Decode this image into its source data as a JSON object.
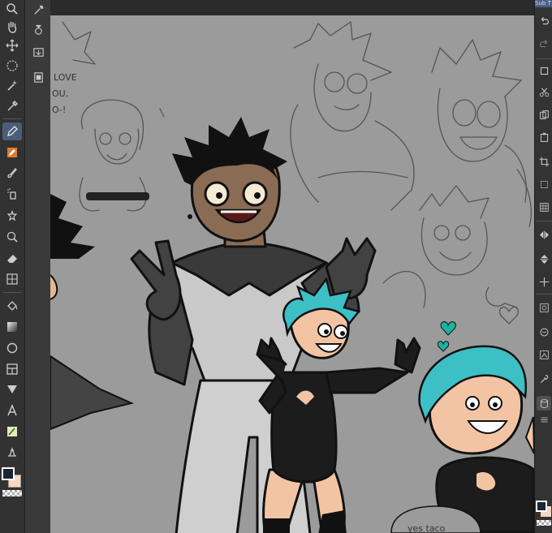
{
  "app": {
    "panel_title": "Sub T"
  },
  "left_toolbar": {
    "tools": [
      {
        "name": "zoom",
        "icon": "magnifier-icon",
        "active": false
      },
      {
        "name": "hand",
        "icon": "hand-icon",
        "active": false
      },
      {
        "name": "move",
        "icon": "move-icon",
        "active": false
      },
      {
        "name": "selection",
        "icon": "lasso-icon",
        "active": false
      },
      {
        "name": "auto-select",
        "icon": "magic-wand-icon",
        "active": false
      },
      {
        "name": "eyedropper",
        "icon": "eyedropper-icon",
        "active": false
      },
      {
        "name": "pen",
        "icon": "pen-icon",
        "active": true
      },
      {
        "name": "pencil",
        "icon": "pencil-icon",
        "active": false
      },
      {
        "name": "brush",
        "icon": "brush-icon",
        "active": false
      },
      {
        "name": "airbrush",
        "icon": "airbrush-icon",
        "active": false
      },
      {
        "name": "decoration",
        "icon": "decoration-icon",
        "active": false
      },
      {
        "name": "blend",
        "icon": "blend-icon",
        "active": false
      },
      {
        "name": "eraser",
        "icon": "eraser-icon",
        "active": false
      },
      {
        "name": "fill",
        "icon": "fill-icon",
        "active": false
      },
      {
        "name": "gradient",
        "icon": "gradient-icon",
        "active": false
      },
      {
        "name": "figure",
        "icon": "circle-icon",
        "active": false
      },
      {
        "name": "frame",
        "icon": "frame-icon",
        "active": false
      },
      {
        "name": "balloon",
        "icon": "balloon-icon",
        "active": false
      },
      {
        "name": "text",
        "icon": "text-icon",
        "active": false
      },
      {
        "name": "correct-line",
        "icon": "correct-line-icon",
        "active": false
      },
      {
        "name": "ruler",
        "icon": "ruler-icon",
        "active": false
      }
    ]
  },
  "sub_toolbar": {
    "items": [
      {
        "icon": "settings-icon"
      },
      {
        "icon": "layer-settings-icon"
      },
      {
        "icon": "import-icon"
      },
      {
        "icon": "film-icon"
      }
    ]
  },
  "colors": {
    "main": "#1a2533",
    "sub": "#f7d7bf",
    "canvas_bg": "#9b9b9b",
    "accent": "#4b5d7a"
  },
  "right_panel": {
    "icons": [
      "undo-icon",
      "redo-icon",
      "layer-icon",
      "cut-icon",
      "copy-icon",
      "paste-icon",
      "crop-icon",
      "transform-icon",
      "grid-icon",
      "flip-horizontal-icon",
      "flip-vertical-icon",
      "move-layer-icon",
      "reference-icon",
      "link-icon",
      "view-icon",
      "wrench-icon",
      "database-icon"
    ]
  },
  "canvas_text": {
    "love_line1": "LOVE",
    "love_line2": "OU,",
    "love_line3": "O-!",
    "bubble_text": "yes  taco"
  }
}
